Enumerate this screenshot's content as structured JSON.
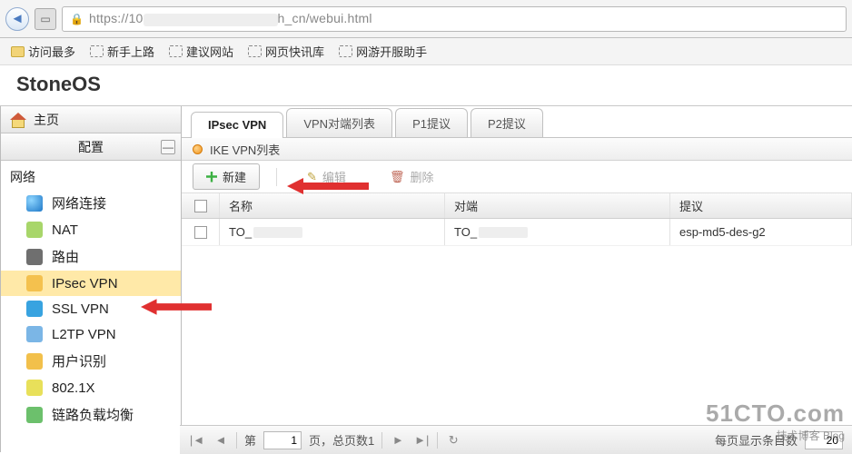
{
  "browser": {
    "url_prefix": "https://10",
    "url_suffix": "h_cn/webui.html"
  },
  "bookmarks": {
    "most_visited": "访问最多",
    "items": [
      "新手上路",
      "建议网站",
      "网页快讯库",
      "网游开服助手"
    ]
  },
  "brand": "StoneOS",
  "sidebar": {
    "home": "主页",
    "config": "配置",
    "section": "网络",
    "items": [
      {
        "label": "网络连接",
        "icon": "i-globe"
      },
      {
        "label": "NAT",
        "icon": "i-nat"
      },
      {
        "label": "路由",
        "icon": "i-route"
      },
      {
        "label": "IPsec VPN",
        "icon": "i-ipsec",
        "selected": true
      },
      {
        "label": "SSL VPN",
        "icon": "i-ssl"
      },
      {
        "label": "L2TP VPN",
        "icon": "i-l2tp"
      },
      {
        "label": "用户识别",
        "icon": "i-user"
      },
      {
        "label": "802.1X",
        "icon": "i-802"
      },
      {
        "label": "链路负载均衡",
        "icon": "i-lb"
      }
    ]
  },
  "tabs": {
    "items": [
      "IPsec VPN",
      "VPN对端列表",
      "P1提议",
      "P2提议"
    ],
    "active": 0
  },
  "panel": {
    "title": "IKE VPN列表",
    "new": "新建",
    "edit": "编辑",
    "del": "删除"
  },
  "grid": {
    "cols": {
      "name": "名称",
      "peer": "对端",
      "prop": "提议"
    },
    "row": {
      "name": "TO_",
      "peer": "TO_",
      "prop": "esp-md5-des-g2"
    }
  },
  "pager": {
    "label_page": "第",
    "page": "1",
    "label_of": "页，总页数1",
    "per_page_label": "每页显示条目数",
    "per_page": "20"
  },
  "watermark": {
    "big": "51CTO.com",
    "sm": "技术博客  Blog"
  }
}
